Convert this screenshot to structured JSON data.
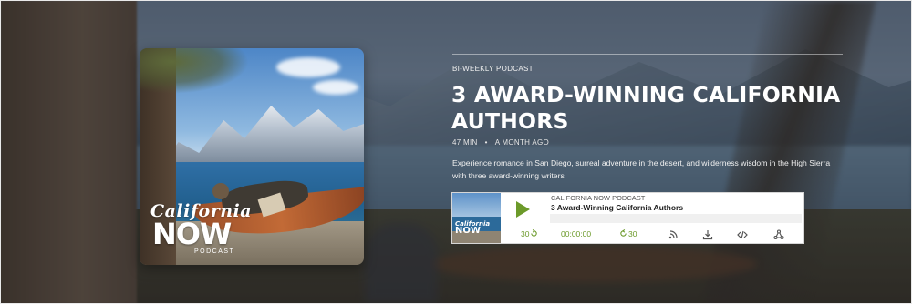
{
  "episode": {
    "eyebrow": "BI-WEEKLY PODCAST",
    "title": "3 AWARD-WINNING CALIFORNIA AUTHORS",
    "duration": "47 MIN",
    "separator": "•",
    "published": "A MONTH AGO",
    "description": "Experience romance in San Diego, surreal adventure in the desert, and wilderness wisdom in the High Sierra with three award-winning writers"
  },
  "cover": {
    "logo_line1": "California",
    "logo_line2": "NOW",
    "logo_line3": "PODCAST"
  },
  "player": {
    "show_name": "CALIFORNIA NOW PODCAST",
    "episode_title": "3 Award-Winning California Authors",
    "thumb_line1": "California",
    "thumb_line2": "NOW",
    "rewind_label": "30",
    "current_time": "00:00:00",
    "forward_label": "30",
    "progress": 0,
    "icons": [
      "play-icon",
      "rewind-icon",
      "forward-icon",
      "rss-icon",
      "download-icon",
      "embed-icon",
      "share-icon"
    ],
    "accent_color": "#6c9a2a"
  }
}
